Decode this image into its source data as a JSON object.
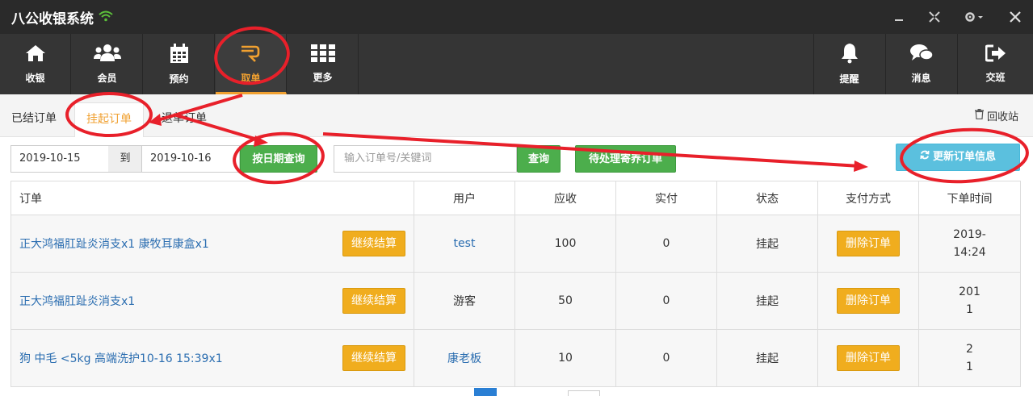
{
  "app": {
    "title": "八公收银系统"
  },
  "nav": {
    "left": [
      {
        "label": "收银",
        "icon": "home-icon"
      },
      {
        "label": "会员",
        "icon": "users-icon"
      },
      {
        "label": "预约",
        "icon": "calendar-icon"
      },
      {
        "label": "取单",
        "icon": "hand-icon"
      },
      {
        "label": "更多",
        "icon": "grid-icon"
      }
    ],
    "right": [
      {
        "label": "提醒",
        "icon": "bell-icon"
      },
      {
        "label": "消息",
        "icon": "chat-icon"
      },
      {
        "label": "交班",
        "icon": "logout-icon"
      }
    ]
  },
  "subtabs": {
    "settled": "已结订单",
    "suspended": "挂起订单",
    "refund": "退单订单",
    "recycle": "回收站"
  },
  "filter": {
    "start_date": "2019-10-15",
    "to": "到",
    "end_date": "2019-10-16",
    "date_query": "按日期查询",
    "search_placeholder": "输入订单号/关键词",
    "search_btn": "查询",
    "pending_btn": "待处理寄养订单",
    "refresh_btn": "更新订单信息"
  },
  "table": {
    "headers": [
      "订单",
      "用户",
      "应收",
      "实付",
      "状态",
      "支付方式",
      "下单时间"
    ],
    "continue_label": "继续结算",
    "delete_label": "删除订单",
    "rows": [
      {
        "order": "正大鸿福肛趾炎消支x1 康牧耳康盒x1",
        "user": "test",
        "user_link": true,
        "due": "100",
        "paid": "0",
        "status": "挂起",
        "time1": "2019-",
        "time2": "14:24"
      },
      {
        "order": "正大鸿福肛趾炎消支x1",
        "user": "游客",
        "user_link": false,
        "due": "50",
        "paid": "0",
        "status": "挂起",
        "time1": "201",
        "time2": "1"
      },
      {
        "order": "狗 中毛 <5kg 高端洗护10-16 15:39x1",
        "user": "康老板",
        "user_link": true,
        "due": "10",
        "paid": "0",
        "status": "挂起",
        "time1": "2",
        "time2": "1"
      }
    ]
  },
  "colors": {
    "accent": "#f0a030",
    "annotation": "#e8202a"
  }
}
